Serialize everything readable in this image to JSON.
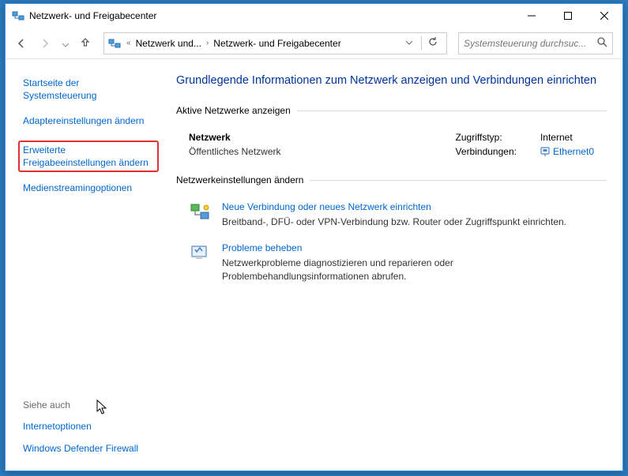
{
  "titlebar": {
    "title": "Netzwerk- und Freigabecenter"
  },
  "breadcrumb": {
    "item1": "Netzwerk und...",
    "item2": "Netzwerk- und Freigabecenter"
  },
  "search": {
    "placeholder": "Systemsteuerung durchsuc..."
  },
  "sidebar": {
    "home": "Startseite der Systemsteuerung",
    "adapter": "Adaptereinstellungen ändern",
    "sharing": "Erweiterte Freigabeeinstellungen ändern",
    "media": "Medienstreamingoptionen",
    "seealso_heading": "Siehe auch",
    "inetopt": "Internetoptionen",
    "firewall": "Windows Defender Firewall"
  },
  "main": {
    "heading": "Grundlegende Informationen zum Netzwerk anzeigen und Verbindungen einrichten",
    "active_label": "Aktive Netzwerke anzeigen",
    "network": {
      "name": "Netzwerk",
      "type": "Öffentliches Netzwerk",
      "access_key": "Zugriffstyp:",
      "access_val": "Internet",
      "conn_key": "Verbindungen:",
      "conn_val": "Ethernet0"
    },
    "change_label": "Netzwerkeinstellungen ändern",
    "setup": {
      "title": "Neue Verbindung oder neues Netzwerk einrichten",
      "desc": "Breitband-, DFÜ- oder VPN-Verbindung bzw. Router oder Zugriffspunkt einrichten."
    },
    "troubleshoot": {
      "title": "Probleme beheben",
      "desc": "Netzwerkprobleme diagnostizieren und reparieren oder Problembehandlungsinformationen abrufen."
    }
  }
}
